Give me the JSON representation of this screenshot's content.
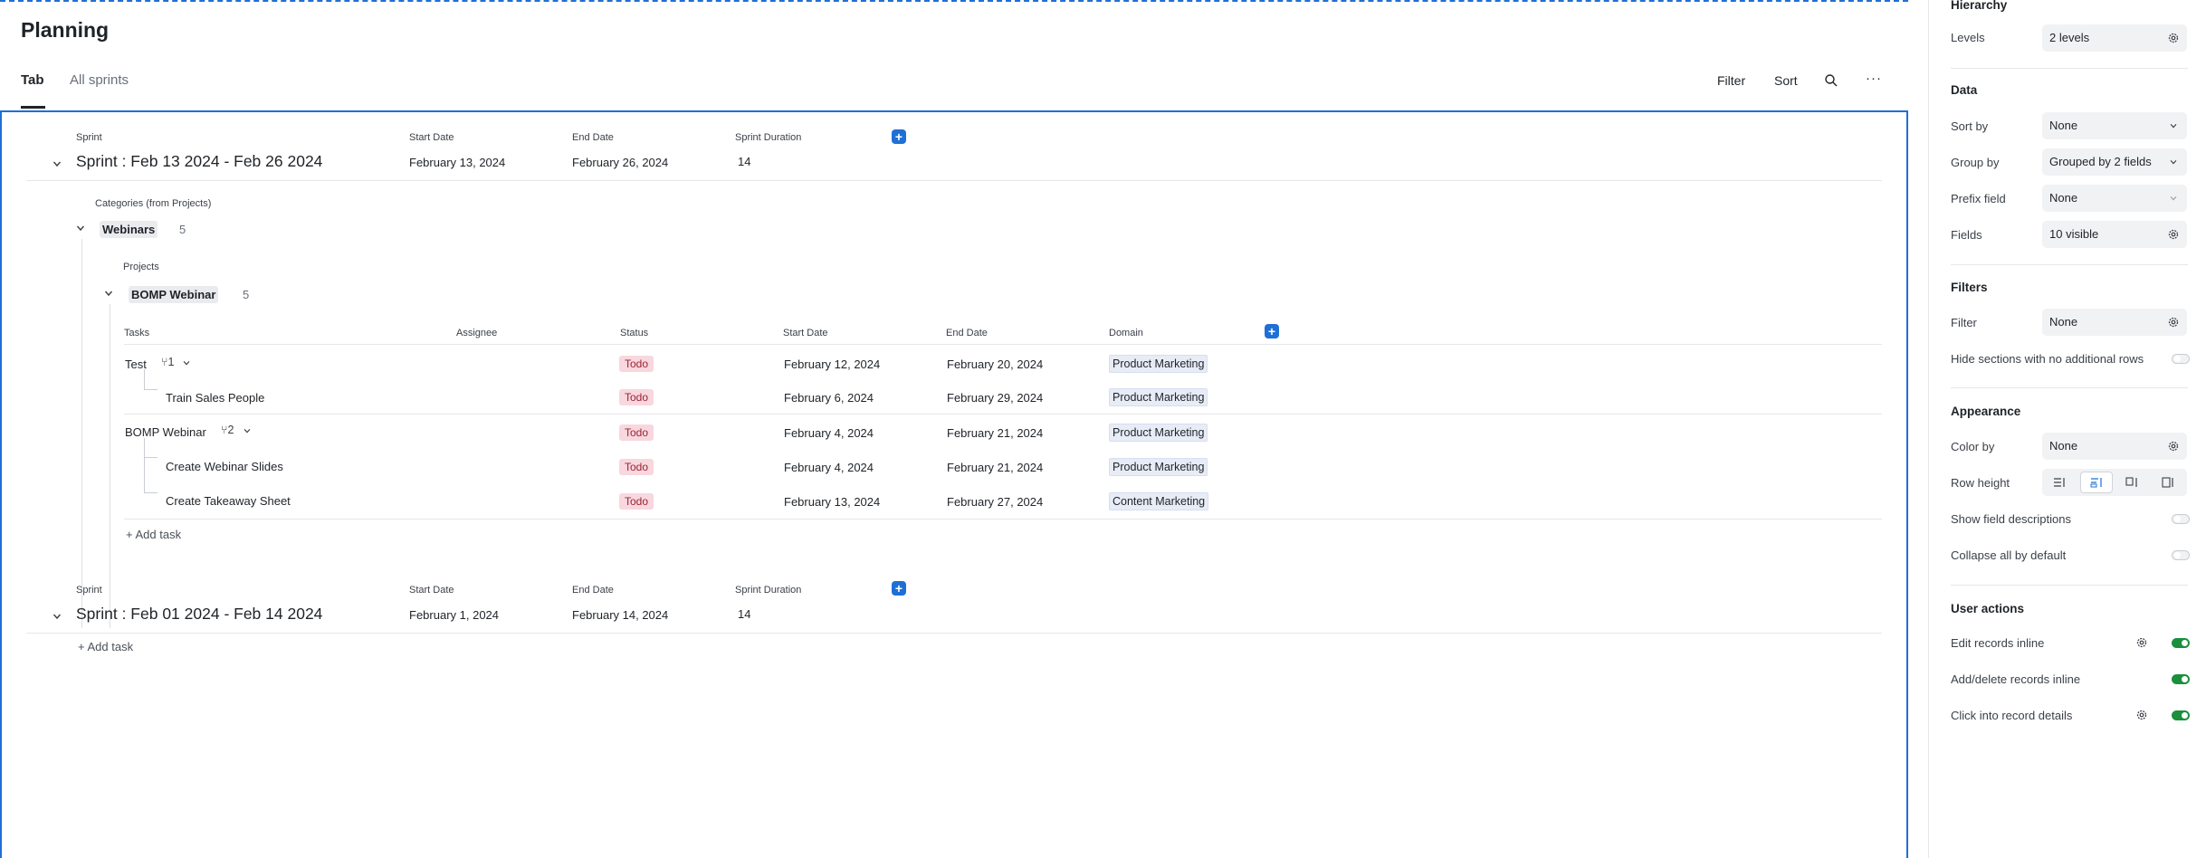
{
  "page": {
    "title": "Planning"
  },
  "tabs": [
    {
      "label": "Tab"
    },
    {
      "label": "All sprints"
    }
  ],
  "toolbar": {
    "filter": "Filter",
    "sort": "Sort"
  },
  "sprint_fields": {
    "sprint": "Sprint",
    "start": "Start Date",
    "end": "End Date",
    "duration": "Sprint Duration"
  },
  "sprints": [
    {
      "name": "Sprint : Feb 13 2024 - Feb 26 2024",
      "start": "February 13, 2024",
      "end": "February 26, 2024",
      "duration": "14"
    },
    {
      "name": "Sprint : Feb 01 2024 - Feb 14 2024",
      "start": "February 1, 2024",
      "end": "February 14, 2024",
      "duration": "14"
    }
  ],
  "category": {
    "label": "Categories (from Projects)",
    "name": "Webinars",
    "count": "5"
  },
  "project": {
    "label": "Projects",
    "name": "BOMP Webinar",
    "count": "5"
  },
  "task_columns": {
    "tasks": "Tasks",
    "assignee": "Assignee",
    "status": "Status",
    "start": "Start Date",
    "end": "End Date",
    "domain": "Domain"
  },
  "tasks": [
    {
      "name": "Test",
      "subcount": "1",
      "status": "Todo",
      "start": "February 12, 2024",
      "end": "February 20, 2024",
      "domain": "Product Marketing"
    },
    {
      "name": "Train Sales People",
      "status": "Todo",
      "start": "February 6, 2024",
      "end": "February 29, 2024",
      "domain": "Product Marketing"
    },
    {
      "name": "BOMP Webinar",
      "subcount": "2",
      "status": "Todo",
      "start": "February 4, 2024",
      "end": "February 21, 2024",
      "domain": "Product Marketing"
    },
    {
      "name": "Create Webinar Slides",
      "status": "Todo",
      "start": "February 4, 2024",
      "end": "February 21, 2024",
      "domain": "Product Marketing"
    },
    {
      "name": "Create Takeaway Sheet",
      "status": "Todo",
      "start": "February 13, 2024",
      "end": "February 27, 2024",
      "domain": "Content Marketing"
    }
  ],
  "add_task": "Add task",
  "panel": {
    "hierarchy": {
      "title": "Hierarchy",
      "levels_label": "Levels",
      "levels_value": "2 levels"
    },
    "data": {
      "title": "Data",
      "sort_label": "Sort by",
      "sort_value": "None",
      "group_label": "Group by",
      "group_value": "Grouped by 2 fields",
      "prefix_label": "Prefix field",
      "prefix_value": "None",
      "fields_label": "Fields",
      "fields_value": "10 visible"
    },
    "filters": {
      "title": "Filters",
      "filter_label": "Filter",
      "filter_value": "None",
      "hide_label": "Hide sections with no additional rows"
    },
    "appearance": {
      "title": "Appearance",
      "color_label": "Color by",
      "color_value": "None",
      "rowheight_label": "Row height",
      "desc_label": "Show field descriptions",
      "collapse_label": "Collapse all by default"
    },
    "user_actions": {
      "title": "User actions",
      "edit_label": "Edit records inline",
      "add_delete_label": "Add/delete records inline",
      "click_label": "Click into record details"
    }
  },
  "colors": {
    "accent": "#1f6fd6",
    "todo_bg": "#f8d7de",
    "toggle_on": "#1a8f3c"
  }
}
